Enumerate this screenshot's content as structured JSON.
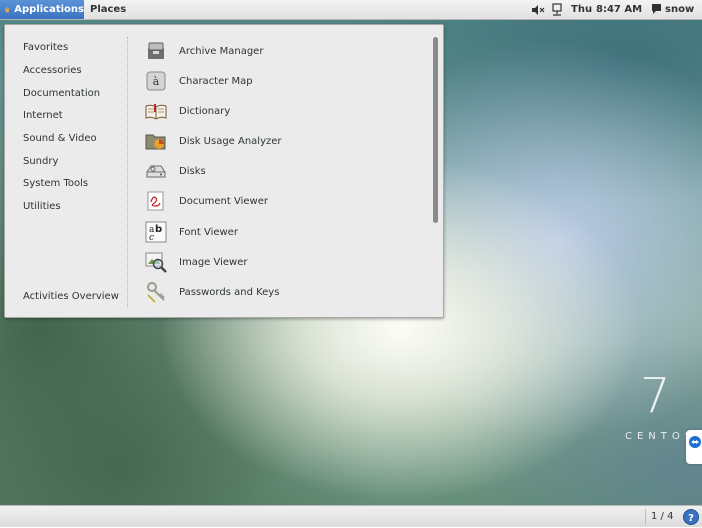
{
  "topbar": {
    "applications_label": "Applications",
    "places_label": "Places",
    "day": "Thu",
    "time": "8:47 AM",
    "user": "snow"
  },
  "menu": {
    "categories": [
      "Favorites",
      "Accessories",
      "Documentation",
      "Internet",
      "Sound & Video",
      "Sundry",
      "System Tools",
      "Utilities"
    ],
    "activities_label": "Activities Overview",
    "apps": [
      {
        "label": "Archive Manager",
        "icon": "archive-manager-icon"
      },
      {
        "label": "Character Map",
        "icon": "character-map-icon"
      },
      {
        "label": "Dictionary",
        "icon": "dictionary-icon"
      },
      {
        "label": "Disk Usage Analyzer",
        "icon": "disk-usage-analyzer-icon"
      },
      {
        "label": "Disks",
        "icon": "disks-icon"
      },
      {
        "label": "Document Viewer",
        "icon": "document-viewer-icon"
      },
      {
        "label": "Font Viewer",
        "icon": "font-viewer-icon"
      },
      {
        "label": "Image Viewer",
        "icon": "image-viewer-icon"
      },
      {
        "label": "Passwords and Keys",
        "icon": "passwords-keys-icon"
      }
    ],
    "charmap_glyph": "à",
    "fontviewer_glyph_a": "a",
    "fontviewer_glyph_b": "b",
    "fontviewer_glyph_c": "c"
  },
  "watermark": {
    "seven": "7",
    "word": "CENTOS"
  },
  "bottombar": {
    "workspace": "1 / 4",
    "help": "?"
  },
  "colors": {
    "accent": "#3a72c0",
    "menu_bg": "#ebebeb",
    "text": "#2e3436"
  }
}
